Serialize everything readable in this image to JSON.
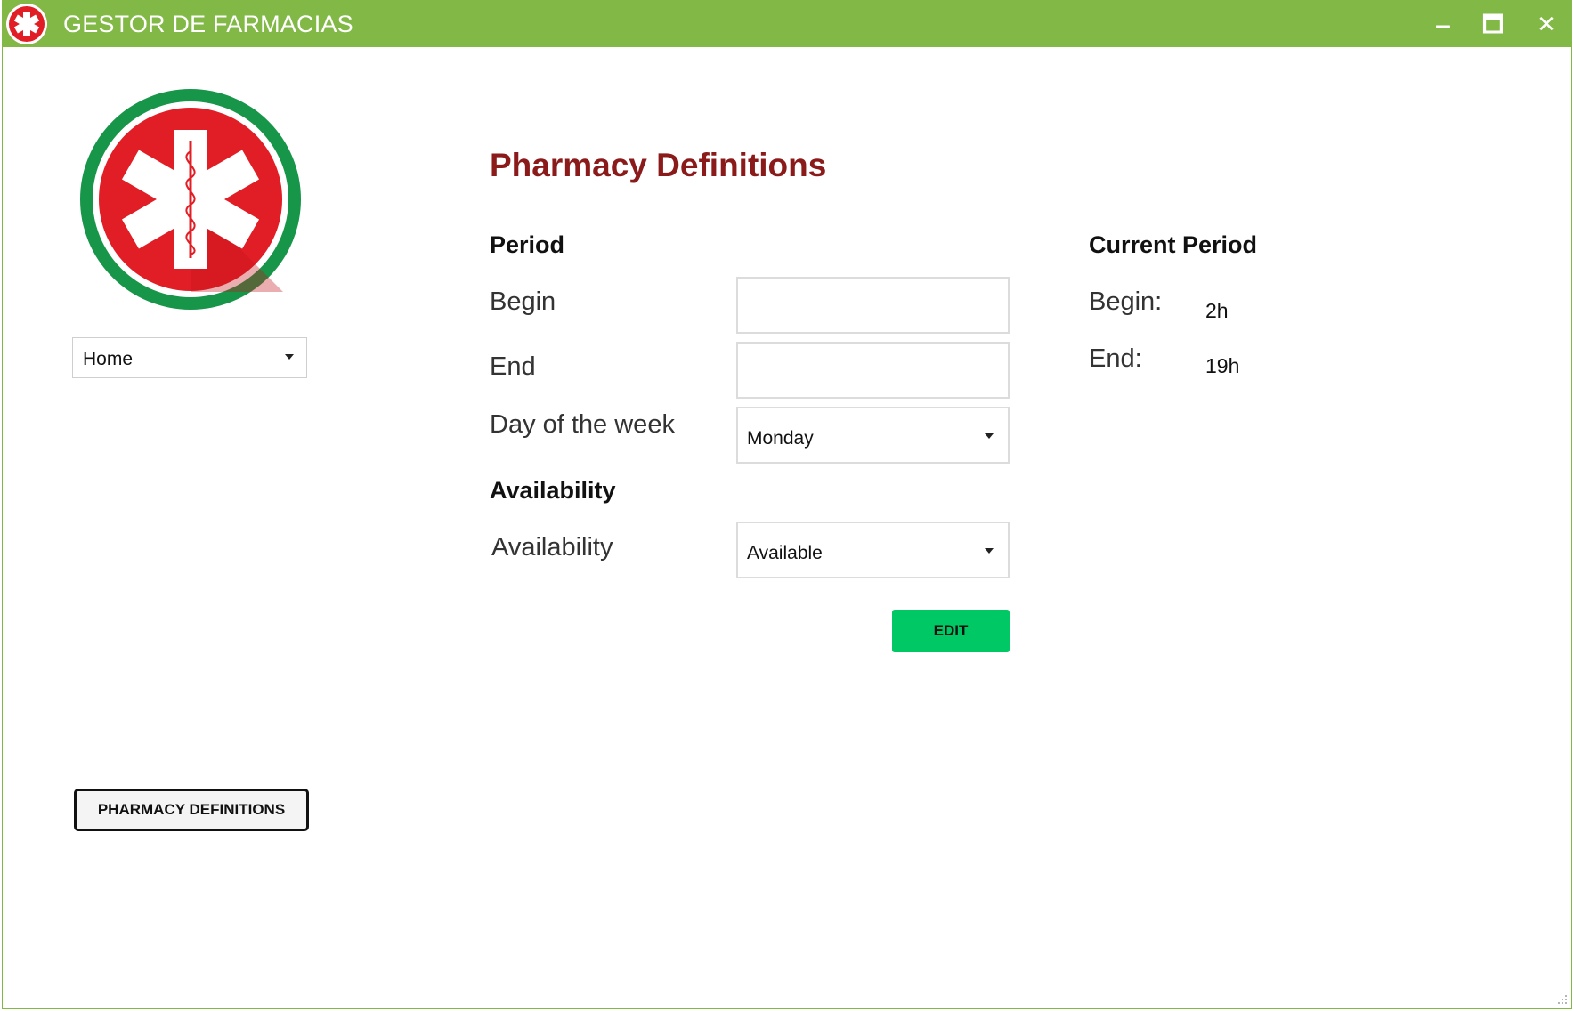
{
  "window": {
    "title": "GESTOR DE FARMACIAS",
    "controls": {
      "minimize": "🗕",
      "maximize": "🗖",
      "close": "✕"
    },
    "accent_color": "#82b946"
  },
  "sidebar": {
    "logo": "star-of-life-logo",
    "nav_select": {
      "value": "Home"
    },
    "pharmacy_definitions_button": "PHARMACY DEFINITIONS"
  },
  "main": {
    "title": "Pharmacy Definitions",
    "title_color": "#8b1a1a",
    "period": {
      "heading": "Period",
      "begin_label": "Begin",
      "begin_value": "",
      "end_label": "End",
      "end_value": "",
      "day_label": "Day of the week",
      "day_value": "Monday"
    },
    "availability": {
      "heading": "Availability",
      "label": "Availability",
      "value": "Available"
    },
    "edit_button": "EDIT",
    "edit_button_color": "#00c864"
  },
  "current_period": {
    "heading": "Current Period",
    "begin_label": "Begin:",
    "begin_value": "2h",
    "end_label": "End:",
    "end_value": "19h"
  }
}
